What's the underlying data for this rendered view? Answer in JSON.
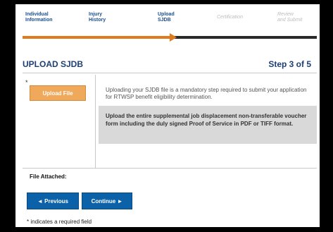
{
  "steps": [
    {
      "line1": "Individual",
      "line2": "Information",
      "state": "done"
    },
    {
      "line1": "Injury",
      "line2": "History",
      "state": "done"
    },
    {
      "line1": "Upload",
      "line2": "SJDB",
      "state": "current"
    },
    {
      "line1": "Certification",
      "line2": "",
      "state": "upcoming"
    },
    {
      "line1": "Review",
      "line2": "and Submit",
      "state": "upcoming"
    }
  ],
  "progress": {
    "completed_steps": 3,
    "total_steps": 5,
    "fill_color": "#e07a1f"
  },
  "page": {
    "title": "UPLOAD SJDB",
    "step_indicator": "Step 3 of 5"
  },
  "upload": {
    "required_marker": "*",
    "button_label": "Upload File",
    "description": "Uploading your SJDB file is a mandatory step required to submit your application for RTWSP benefit eligibility determination.",
    "note": "Upload the entire supplemental job displacement non-transferable voucher form including the duly signed Proof of Service in PDF or TIFF format."
  },
  "file_attached_label": "File Attached:",
  "nav": {
    "previous_label": "◄ Previous",
    "continue_label": "Continue ►"
  },
  "footer": {
    "required_note": "* indicates a required field"
  },
  "colors": {
    "accent": "#e07a1f",
    "primary": "#0b62a8",
    "heading": "#1d3f76"
  }
}
